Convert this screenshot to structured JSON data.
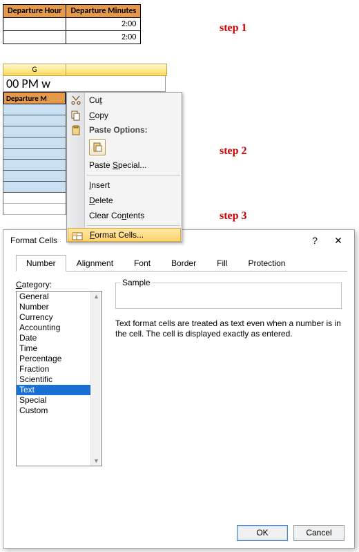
{
  "step_labels": {
    "s1": "step 1",
    "s2": "step 2",
    "s3": "step 3"
  },
  "step1_table": {
    "headers": [
      "Departure Hour",
      "Departure Minutes"
    ],
    "rows": [
      {
        "c1": "",
        "c2": "2:00"
      },
      {
        "c1": "",
        "c2": "2:00"
      }
    ]
  },
  "step2": {
    "col_headers": {
      "g": "G",
      "h": ""
    },
    "formula_bar": "00 PM w",
    "sel_header": "Departure M",
    "ctx": {
      "cut_pre": "Cu",
      "cut_u": "t",
      "copy_u": "C",
      "copy_post": "opy",
      "paste_opt_header": "Paste Options:",
      "paste_special_pre": "Paste ",
      "paste_special_u": "S",
      "paste_special_post": "pecial...",
      "insert_u": "I",
      "insert_post": "nsert",
      "delete_u": "D",
      "delete_post": "elete",
      "clear_pre": "Clear Co",
      "clear_u": "n",
      "clear_post": "tents",
      "format_u": "F",
      "format_post": "ormat Cells..."
    }
  },
  "dialog": {
    "title": "Format Cells",
    "help_btn": "?",
    "close_btn": "✕",
    "tabs": [
      "Number",
      "Alignment",
      "Font",
      "Border",
      "Fill",
      "Protection"
    ],
    "active_tab": 0,
    "category_label_u": "C",
    "category_label_post": "ategory:",
    "categories": [
      "General",
      "Number",
      "Currency",
      "Accounting",
      "Date",
      "Time",
      "Percentage",
      "Fraction",
      "Scientific",
      "Text",
      "Special",
      "Custom"
    ],
    "selected_category_index": 9,
    "sample_label": "Sample",
    "description": "Text format cells are treated as text even when a number is in the cell. The cell is displayed exactly as entered.",
    "ok": "OK",
    "cancel": "Cancel"
  }
}
